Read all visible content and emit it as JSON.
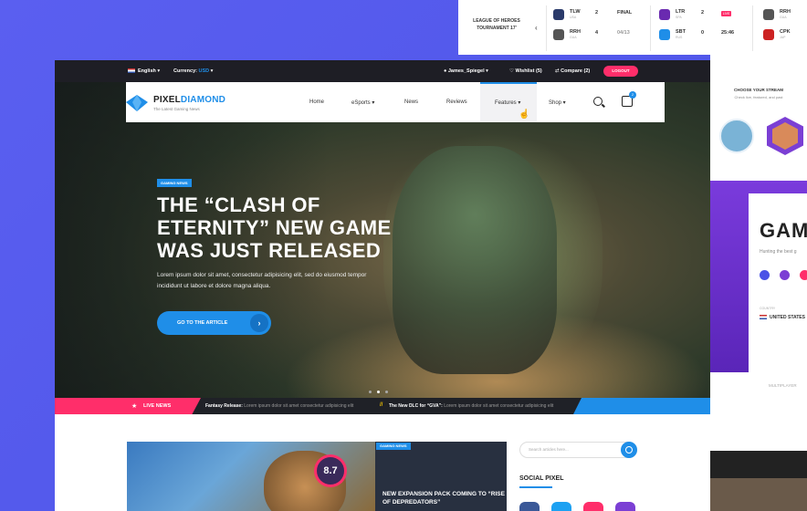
{
  "scores": {
    "league": "LEAGUE OF HEROES TOURNAMENT 17'",
    "matches": [
      {
        "team1": "TLW",
        "region1": "USA",
        "score1": "2",
        "team2": "RRH",
        "region2": "GUA",
        "score2": "4",
        "status": "FINAL",
        "date": "04/13"
      },
      {
        "team1": "LTR",
        "region1": "SPA",
        "score1": "2",
        "team2": "SBT",
        "region2": "RUS",
        "score2": "0",
        "status": "LIVE",
        "time": "25:46"
      },
      {
        "team1": "RRH",
        "region1": "GUA",
        "team2": "CPK",
        "region2": "JAP"
      }
    ]
  },
  "topbar": {
    "language": "English",
    "currency_label": "Currency:",
    "currency_value": "USD",
    "user": "James_Spiegel",
    "wishlist": "Wishlist (5)",
    "compare": "Compare (2)",
    "logout": "LOGOUT"
  },
  "nav": {
    "logo_main": "PIXEL",
    "logo_accent": "DIAMOND",
    "tagline": "The Latest Gaming News",
    "items": [
      "Home",
      "eSports",
      "News",
      "Reviews",
      "Features",
      "Shop"
    ],
    "cart_count": "2"
  },
  "hero": {
    "badge": "GAMING NEWS",
    "title": "THE “CLASH OF ETERNITY” NEW GAME WAS JUST RELEASED",
    "description": "Lorem ipsum dolor sit amet, consectetur adipisicing elit, sed do eiusmod tempor incididunt ut labore et dolore magna aliqua.",
    "cta": "GO TO THE ARTICLE"
  },
  "ticker": {
    "label": "LIVE NEWS",
    "item1_title": "Fantasy Release:",
    "item1_text": "Lorem ipsum dolor sit amet consectetur adipisicing elit",
    "item2_title": "The New DLC for “GVA”:",
    "item2_text": "Lorem ipsum dolor sit amet consectetur adipisicing elit"
  },
  "cards": {
    "score": "8.7",
    "card2_badge": "GAMING NEWS",
    "card2_title": "NEW EXPANSION PACK COMING TO “RISE OF DEPREDATORS”"
  },
  "sidebar": {
    "search_placeholder": "Search articles here...",
    "social_title": "SOCIAL PIXEL"
  },
  "right_preview": {
    "heading": "CHOOSE YOUR STREAM",
    "sub": "Check live, featured, and past",
    "big": "GAM",
    "hunting": "Hunting the best g",
    "country_label": "COUNTRY",
    "country": "UNITED STATES",
    "multiplayer": "MULTIPLAYER"
  },
  "colors": {
    "accent": "#1f8ee8",
    "pink": "#ff2e6a",
    "purple": "#5a5ff0",
    "dark": "#1e1e25"
  }
}
